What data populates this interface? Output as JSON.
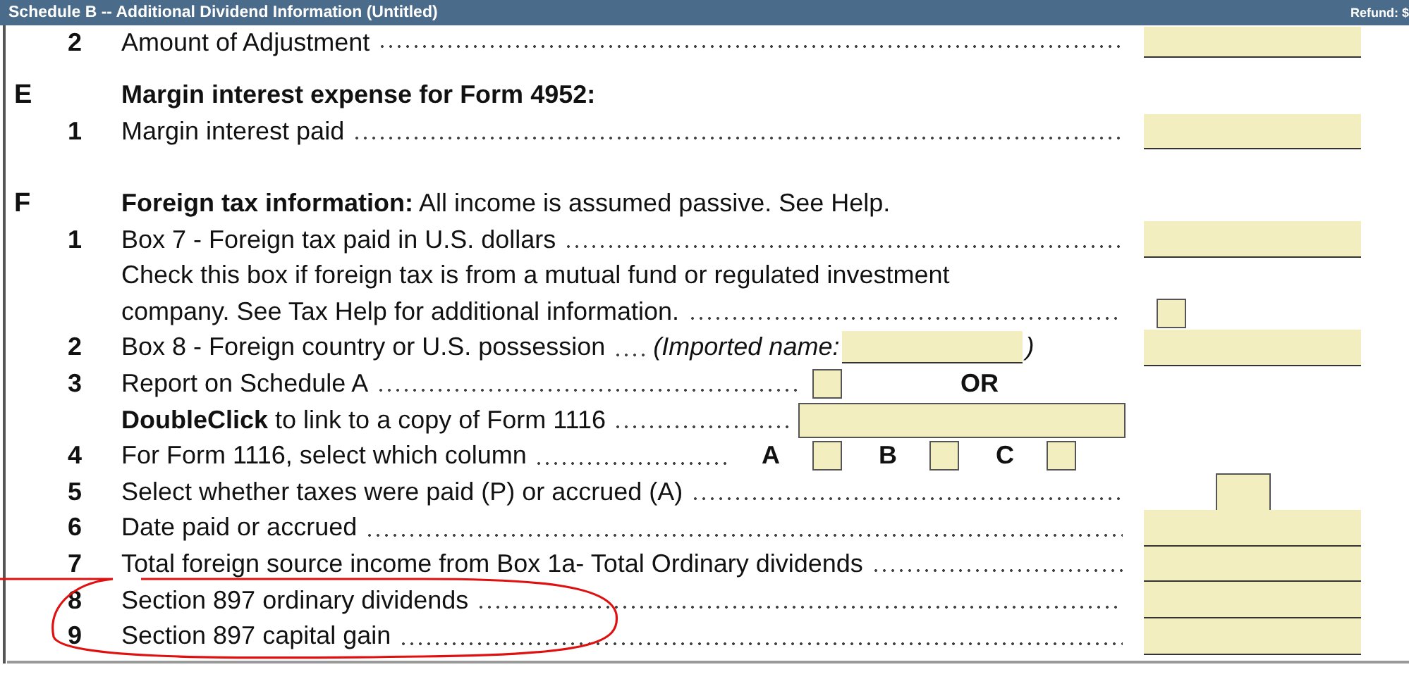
{
  "window": {
    "title": "Schedule B -- Additional Dividend Information (Untitled)",
    "refund_label": "Refund: $"
  },
  "partial_line": {
    "number": "2",
    "label": "Amount of Adjustment"
  },
  "sections": [
    {
      "letter": "E",
      "heading": "Margin interest expense for Form 4952:",
      "lines": [
        {
          "kind": "amount",
          "number": "1",
          "label": "Margin interest paid"
        }
      ]
    },
    {
      "letter": "F",
      "heading": "Foreign tax information:",
      "note": "All income is assumed passive. See Help.",
      "lines": [
        {
          "kind": "amount",
          "number": "1",
          "label": "Box 7  - Foreign tax paid in U.S. dollars"
        },
        {
          "kind": "text",
          "label": "Check this box if foreign tax is from a mutual fund or regulated investment"
        },
        {
          "kind": "checkbox",
          "label": "company. See Tax Help for additional information.",
          "checked": false
        },
        {
          "kind": "country",
          "number": "2",
          "label": "Box 8  - Foreign country or U.S. possession",
          "imported_label": "(Imported name:",
          "close": ")"
        },
        {
          "kind": "schedule_a",
          "number": "3",
          "label": "Report on Schedule A",
          "checked": false,
          "or_label": "OR"
        },
        {
          "kind": "link_field",
          "label": "**DoubleClick** to link to a copy of Form 1116"
        },
        {
          "kind": "columns",
          "number": "4",
          "label": "For Form 1116, select which column",
          "options": [
            {
              "label": "A",
              "checked": false
            },
            {
              "label": "B",
              "checked": false
            },
            {
              "label": "C",
              "checked": false
            }
          ]
        },
        {
          "kind": "code",
          "number": "5",
          "label": "Select whether taxes were paid (P) or accrued (A)"
        },
        {
          "kind": "amount",
          "number": "6",
          "label": "Date paid or accrued"
        },
        {
          "kind": "amount",
          "number": "7",
          "label": "Total foreign source income from Box 1a- Total Ordinary dividends"
        },
        {
          "kind": "amount",
          "number": "8",
          "label": "Section 897 ordinary dividends"
        },
        {
          "kind": "amount",
          "number": "9",
          "label": "Section 897 capital gain"
        }
      ]
    }
  ]
}
